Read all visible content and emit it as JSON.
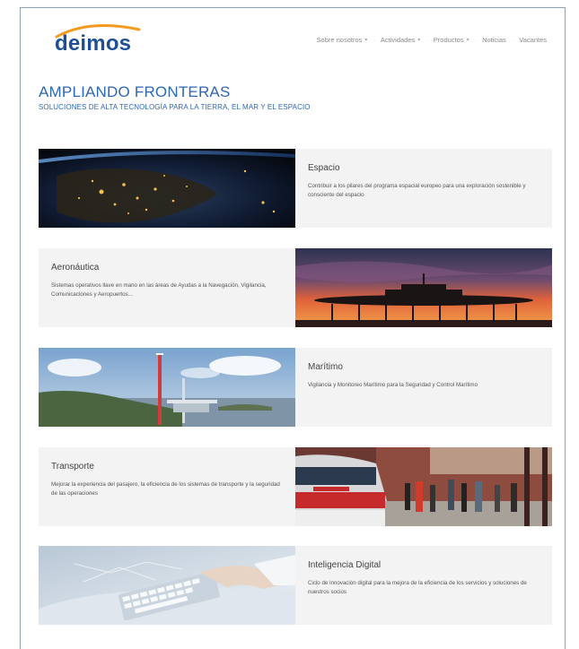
{
  "brand": {
    "logo_text": "deimos",
    "arc_color": "#f39a1f",
    "text_color": "#1d4f96"
  },
  "nav": {
    "items": [
      {
        "label": "Sobre nosotros",
        "dropdown": true
      },
      {
        "label": "Actividades",
        "dropdown": true
      },
      {
        "label": "Productos",
        "dropdown": true
      },
      {
        "label": "Noticias",
        "dropdown": false
      },
      {
        "label": "Vacantes",
        "dropdown": false
      }
    ],
    "chevron": "▾"
  },
  "hero": {
    "title": "AMPLIANDO FRONTERAS",
    "subtitle": "SOLUCIONES DE ALTA TECNOLOGÍA PARA LA TIERRA, EL MAR Y EL ESPACIO"
  },
  "sections": [
    {
      "title": "Espacio",
      "description": "Contribuir a los pilares del programa espacial europeo para una exploración sostenible y consciente del espacio",
      "image": "earth-night-image"
    },
    {
      "title": "Aeronáutica",
      "description": "Sistemas operativos llave en mano en las áreas de Ayudas a la Navegación, Vigilancia, Comunicaciones y Aeropuertos...",
      "image": "radar-sunset-image"
    },
    {
      "title": "Marítimo",
      "description": "Vigilancia y Monitoreo Marítimo para la Seguridad y Control Marítimo",
      "image": "coast-antenna-image"
    },
    {
      "title": "Transporte",
      "description": "Mejorar la experiencia del pasajero, la eficiencia de los sistemas de transporte y la seguridad de las operaciones",
      "image": "train-station-image"
    },
    {
      "title": "Inteligencia Digital",
      "description": "Ciclo de innovación digital para la mejora de la eficiencia de los servicios y soluciones de nuestros socios",
      "image": "keyboard-hand-image"
    }
  ]
}
